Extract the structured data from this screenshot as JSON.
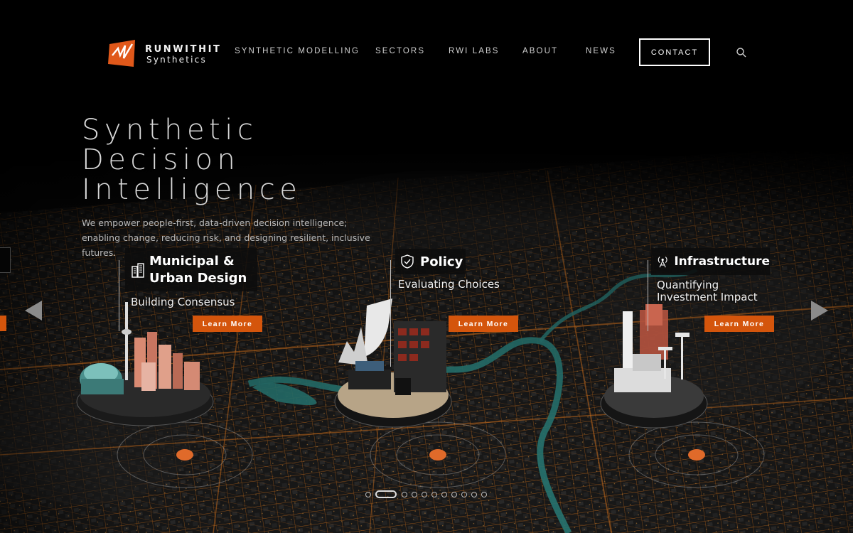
{
  "brand": {
    "name_line1": "RUNWITHIT",
    "name_line2": "Synthetics",
    "accent_color": "#d4550c"
  },
  "nav": {
    "items": [
      {
        "label": "SYNTHETIC MODELLING"
      },
      {
        "label": "SECTORS"
      },
      {
        "label": "RWI LABS"
      },
      {
        "label": "ABOUT"
      },
      {
        "label": "NEWS"
      }
    ],
    "contact_label": "CONTACT",
    "search_icon": "search-icon"
  },
  "hero": {
    "title_lines": [
      "Synthetic",
      "Decision",
      "Intelligence"
    ],
    "subtitle": "We empower people-first, data-driven decision intelligence; enabling change, reducing risk, and designing resilient, inclusive futures."
  },
  "sectors": [
    {
      "icon": "buildings-icon",
      "title_lines": [
        "Municipal &",
        "Urban Design"
      ],
      "subtitle_lines": [
        "Building Consensus"
      ],
      "button": "Learn More"
    },
    {
      "icon": "shield-icon",
      "title_lines": [
        "Policy"
      ],
      "subtitle_lines": [
        "Evaluating Choices"
      ],
      "button": "Learn More"
    },
    {
      "icon": "radio-tower-icon",
      "title_lines": [
        "Infrastructure"
      ],
      "subtitle_lines": [
        "Quantifying",
        "Investment Impact"
      ],
      "button": "Learn More"
    }
  ],
  "carousel": {
    "prev_icon": "chevron-left-icon",
    "next_icon": "chevron-right-icon",
    "slide_count": 12,
    "active_slide": 2
  }
}
